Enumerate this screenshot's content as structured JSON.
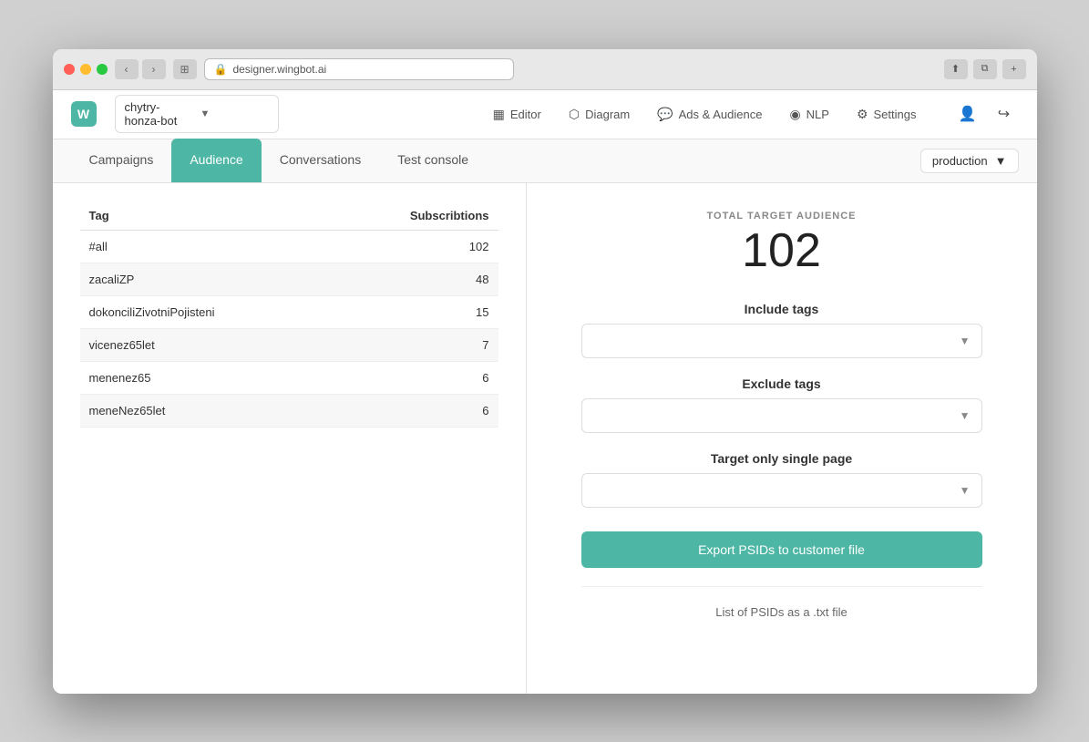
{
  "browser": {
    "url": "designer.wingbot.ai",
    "nav_back": "‹",
    "nav_forward": "›",
    "tab_icon": "⊞"
  },
  "app": {
    "logo_text": "W",
    "bot_name": "chytry-honza-bot",
    "nav_items": [
      {
        "id": "editor",
        "label": "Editor",
        "icon": "▦"
      },
      {
        "id": "diagram",
        "label": "Diagram",
        "icon": "⬡"
      },
      {
        "id": "ads_audience",
        "label": "Ads & Audience",
        "icon": "💬"
      },
      {
        "id": "nlp",
        "label": "NLP",
        "icon": "◎"
      },
      {
        "id": "settings",
        "label": "Settings",
        "icon": "⚙"
      }
    ]
  },
  "tabs": {
    "items": [
      {
        "id": "campaigns",
        "label": "Campaigns",
        "active": false
      },
      {
        "id": "audience",
        "label": "Audience",
        "active": true
      },
      {
        "id": "conversations",
        "label": "Conversations",
        "active": false
      },
      {
        "id": "test_console",
        "label": "Test console",
        "active": false
      }
    ],
    "env_label": "production"
  },
  "table": {
    "col_tag": "Tag",
    "col_subscriptions": "Subscribtions",
    "rows": [
      {
        "tag": "#all",
        "subscriptions": "102"
      },
      {
        "tag": "zacaliZP",
        "subscriptions": "48"
      },
      {
        "tag": "dokonciliZivotniPojisteni",
        "subscriptions": "15"
      },
      {
        "tag": "vicenez65let",
        "subscriptions": "7"
      },
      {
        "tag": "menenez65",
        "subscriptions": "6"
      },
      {
        "tag": "meneNez65let",
        "subscriptions": "6"
      }
    ]
  },
  "audience": {
    "total_label": "TOTAL TARGET AUDIENCE",
    "total_value": "102",
    "include_tags_label": "Include tags",
    "include_tags_placeholder": "",
    "exclude_tags_label": "Exclude tags",
    "exclude_tags_placeholder": "",
    "single_page_label": "Target only single page",
    "single_page_placeholder": "",
    "export_btn_label": "Export PSIDs to customer file",
    "list_psids_text": "List of PSIDs as a .txt file"
  }
}
